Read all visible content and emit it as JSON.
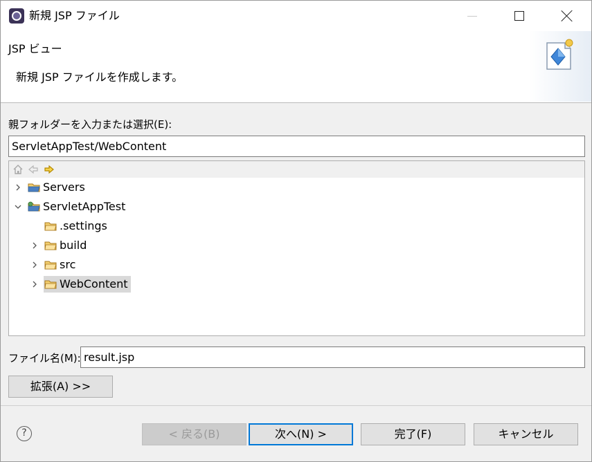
{
  "window": {
    "title": "新規 JSP ファイル"
  },
  "banner": {
    "title": "JSP ビュー",
    "message": "新規 JSP ファイルを作成します。"
  },
  "parent_folder": {
    "label": "親フォルダーを入力または選択(E):",
    "value": "ServletAppTest/WebContent"
  },
  "tree_toolbar": [
    "home-icon",
    "back-icon",
    "forward-icon"
  ],
  "tree": [
    {
      "label": "Servers",
      "expanded": false,
      "icon": "folder-icon"
    },
    {
      "label": "ServletAppTest",
      "expanded": true,
      "icon": "project-icon"
    },
    {
      "label": ".settings",
      "icon": "folder-icon"
    },
    {
      "label": "build",
      "expanded": false,
      "icon": "folder-icon"
    },
    {
      "label": "src",
      "expanded": false,
      "icon": "folder-icon"
    },
    {
      "label": "WebContent",
      "expanded": false,
      "icon": "folder-icon",
      "selected": true
    }
  ],
  "file_name": {
    "label": "ファイル名(M):",
    "value": "result.jsp"
  },
  "advanced_button": "拡張(A) >>",
  "buttons": {
    "back": "< 戻る(B)",
    "next": "次へ(N) >",
    "finish": "完了(F)",
    "cancel": "キャンセル"
  },
  "help": "?",
  "colors": {
    "accent": "#0078d7",
    "selection": "#d9d9d9",
    "folder": "#e8b84a"
  }
}
